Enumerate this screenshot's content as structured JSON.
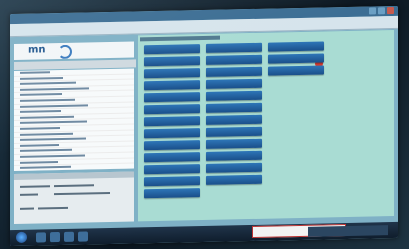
{
  "window": {
    "title": "",
    "titlebar_color": "#3b6d93",
    "controls": [
      "minimize-icon",
      "maximize-icon",
      "close-icon"
    ]
  },
  "app": {
    "logo_text": "mn",
    "accent": "#23588f"
  },
  "sidebar": {
    "header": "",
    "items": [
      {
        "label": ""
      },
      {
        "label": ""
      },
      {
        "label": ""
      },
      {
        "label": ""
      },
      {
        "label": ""
      },
      {
        "label": ""
      },
      {
        "label": ""
      },
      {
        "label": ""
      },
      {
        "label": ""
      },
      {
        "label": ""
      },
      {
        "label": ""
      },
      {
        "label": ""
      },
      {
        "label": ""
      },
      {
        "label": ""
      },
      {
        "label": ""
      },
      {
        "label": ""
      },
      {
        "label": ""
      },
      {
        "label": ""
      },
      {
        "label": ""
      },
      {
        "label": ""
      }
    ]
  },
  "details": {
    "lines": [
      "",
      "",
      "",
      "",
      ""
    ]
  },
  "main": {
    "header": "",
    "background": "#a9dcd3",
    "tile_color": "#2e76b8",
    "columns": [
      {
        "tiles": 13
      },
      {
        "tiles": 12
      },
      {
        "tiles": 3
      }
    ],
    "status_dot_color": "#d23a2f"
  },
  "taskbar": {
    "notification_text": "",
    "icons": [
      "windows-start-icon",
      "folder-icon",
      "browser-icon",
      "app-icon",
      "app-icon"
    ]
  }
}
